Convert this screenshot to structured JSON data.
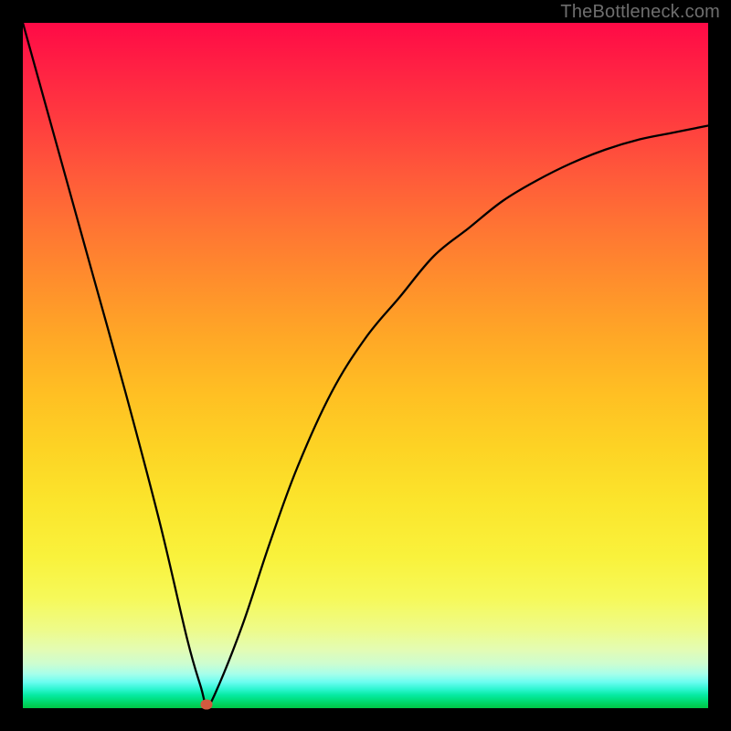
{
  "watermark": "TheBottleneck.com",
  "chart_data": {
    "type": "line",
    "title": "",
    "xlabel": "",
    "ylabel": "",
    "xlim": [
      0,
      100
    ],
    "ylim": [
      0,
      100
    ],
    "grid": false,
    "legend": false,
    "background_gradient": {
      "direction": "vertical",
      "stops": [
        {
          "pos": 0,
          "color": "#ff0a46"
        },
        {
          "pos": 50,
          "color": "#ffbf23"
        },
        {
          "pos": 85,
          "color": "#f6f95a"
        },
        {
          "pos": 100,
          "color": "#00c647"
        }
      ],
      "note": "red→yellow→green top-to-bottom; implies y=100 is bad (red), y=0 is good (green)"
    },
    "series": [
      {
        "name": "bottleneck-curve",
        "type": "line",
        "color": "#000000",
        "x": [
          0,
          5,
          10,
          15,
          20,
          24,
          26,
          26.8,
          28,
          32,
          36,
          40,
          45,
          50,
          55,
          60,
          65,
          70,
          75,
          80,
          85,
          90,
          95,
          100
        ],
        "values": [
          100,
          82,
          64,
          46,
          27,
          10,
          3,
          0.5,
          2,
          12,
          24,
          35,
          46,
          54,
          60,
          66,
          70,
          74,
          77,
          79.5,
          81.5,
          83,
          84,
          85
        ]
      }
    ],
    "marker": {
      "name": "optimal-point",
      "x": 26.8,
      "y": 0.5,
      "color": "#d35a3f"
    }
  }
}
